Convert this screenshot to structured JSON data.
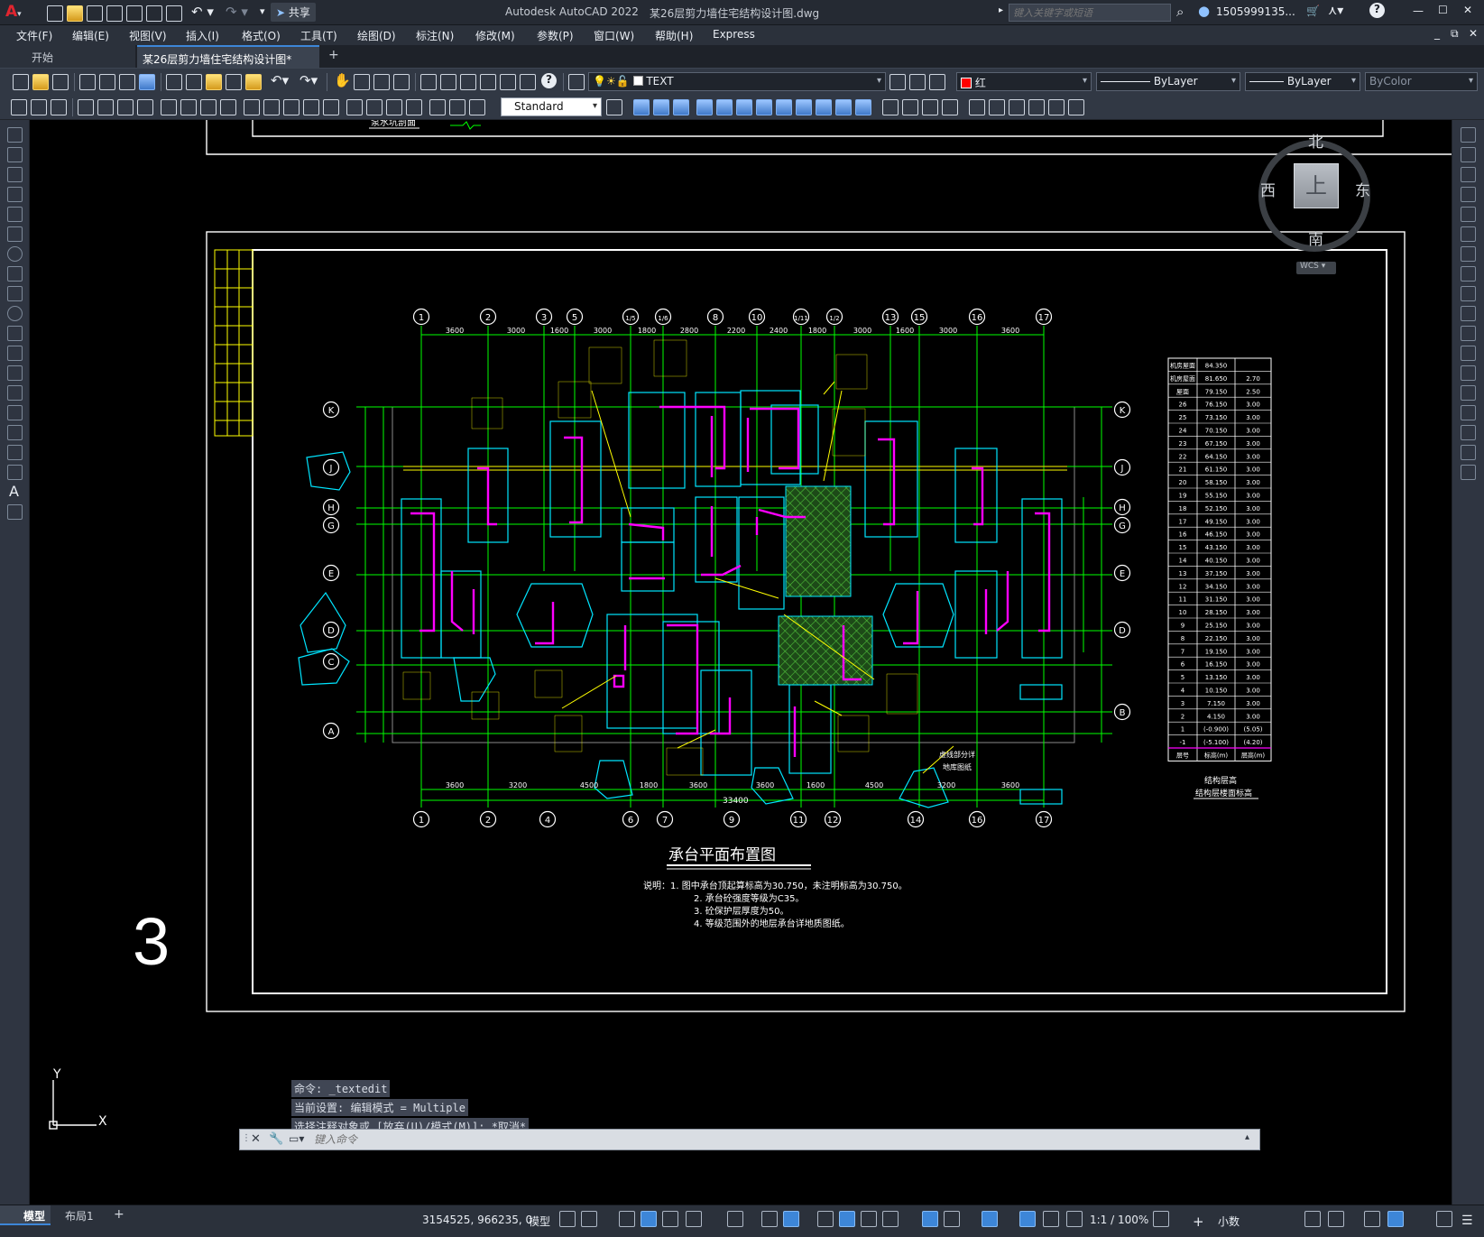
{
  "window": {
    "app_title": "Autodesk AutoCAD 2022",
    "file_title": "某26层剪力墙住宅结构设计图.dwg",
    "search_placeholder": "键入关键字或短语",
    "user": "1505999135...",
    "share": "共享",
    "minimize": "—",
    "maximize": "☐",
    "close": "✕"
  },
  "menu": [
    "文件(F)",
    "编辑(E)",
    "视图(V)",
    "插入(I)",
    "格式(O)",
    "工具(T)",
    "绘图(D)",
    "标注(N)",
    "修改(M)",
    "参数(P)",
    "窗口(W)",
    "帮助(H)",
    "Express"
  ],
  "tabs": {
    "start": "开始",
    "active": "某26层剪力墙住宅结构设计图*",
    "add": "+"
  },
  "toolbar": {
    "layer": "TEXT",
    "color": "红",
    "linetype": "ByLayer",
    "lineweight": "ByLayer",
    "plotstyle": "ByColor",
    "textstyle": "Standard"
  },
  "viewcube": {
    "north": "北",
    "south": "南",
    "east": "东",
    "west": "西",
    "top": "上",
    "wcs": "WCS"
  },
  "drawing": {
    "prev_title": "泵水坑剖面",
    "title": "承台平面布置图",
    "notes": [
      "说明：1. 图中承台顶起算标高为30.750，未注明标高为30.750。",
      "2. 承台砼强度等级为C35。",
      "3. 砼保护层厚度为50。",
      "4. 等级范围外的地层承台详地质图纸。"
    ],
    "sheet_number": "3",
    "grid_top": [
      "1",
      "2",
      "3",
      "5",
      "1/5",
      "1/6",
      "8",
      "10",
      "1/11",
      "1/2",
      "13",
      "15",
      "16",
      "17"
    ],
    "grid_bottom": [
      "1",
      "2",
      "4",
      "6",
      "7",
      "9",
      "11",
      "12",
      "14",
      "16",
      "17"
    ],
    "grid_rows": [
      "K",
      "J",
      "H",
      "G",
      "E",
      "D",
      "C",
      "A",
      "B"
    ],
    "dims_top": [
      "3600",
      "3000",
      "1600",
      "3000",
      "1800",
      "2800",
      "2200",
      "2400",
      "1800",
      "3000",
      "1600",
      "3000",
      "3600"
    ],
    "dims_bottom": [
      "3600",
      "3200",
      "4500",
      "1800",
      "3600",
      "3600",
      "1600",
      "4500",
      "3200",
      "3600"
    ],
    "total_dim": "33400",
    "elevation_note": [
      "结构层高",
      "结构层楼面标高"
    ],
    "callout": [
      "虚线部分详",
      "地库图纸"
    ]
  },
  "elevation_table": {
    "header": [
      "层号",
      "标高(m)",
      "层高(m)"
    ],
    "rows": [
      [
        "机房屋面",
        "84.350",
        ""
      ],
      [
        "机房屋面",
        "81.650",
        "2.70"
      ],
      [
        "屋面",
        "79.150",
        "2.50"
      ],
      [
        "26",
        "76.150",
        "3.00"
      ],
      [
        "25",
        "73.150",
        "3.00"
      ],
      [
        "24",
        "70.150",
        "3.00"
      ],
      [
        "23",
        "67.150",
        "3.00"
      ],
      [
        "22",
        "64.150",
        "3.00"
      ],
      [
        "21",
        "61.150",
        "3.00"
      ],
      [
        "20",
        "58.150",
        "3.00"
      ],
      [
        "19",
        "55.150",
        "3.00"
      ],
      [
        "18",
        "52.150",
        "3.00"
      ],
      [
        "17",
        "49.150",
        "3.00"
      ],
      [
        "16",
        "46.150",
        "3.00"
      ],
      [
        "15",
        "43.150",
        "3.00"
      ],
      [
        "14",
        "40.150",
        "3.00"
      ],
      [
        "13",
        "37.150",
        "3.00"
      ],
      [
        "12",
        "34.150",
        "3.00"
      ],
      [
        "11",
        "31.150",
        "3.00"
      ],
      [
        "10",
        "28.150",
        "3.00"
      ],
      [
        "9",
        "25.150",
        "3.00"
      ],
      [
        "8",
        "22.150",
        "3.00"
      ],
      [
        "7",
        "19.150",
        "3.00"
      ],
      [
        "6",
        "16.150",
        "3.00"
      ],
      [
        "5",
        "13.150",
        "3.00"
      ],
      [
        "4",
        "10.150",
        "3.00"
      ],
      [
        "3",
        "7.150",
        "3.00"
      ],
      [
        "2",
        "4.150",
        "3.00"
      ],
      [
        "1",
        "(-0.900)",
        "(5.05)"
      ],
      [
        "-1",
        "(-5.100)",
        "(4.20)"
      ]
    ]
  },
  "ucs": {
    "x": "X",
    "y": "Y"
  },
  "command": {
    "history": [
      "命令: _textedit",
      "当前设置: 编辑模式 = Multiple",
      "选择注释对象或 [放弃(U)/模式(M)]: *取消*"
    ],
    "placeholder": "键入命令"
  },
  "layout_tabs": {
    "model": "模型",
    "layout1": "布局1",
    "add": "+"
  },
  "status": {
    "coords": "3154525, 966235, 0",
    "space": "模型",
    "scale": "1:1 / 100%",
    "units": "小数"
  },
  "colors": {
    "accent": "#3d86d8",
    "cyan": "#00ffff",
    "yellow": "#ffff00",
    "magenta": "#ff00ff",
    "green": "#00ff00",
    "hatch": "#3a8b2a",
    "red": "#ff0000"
  }
}
